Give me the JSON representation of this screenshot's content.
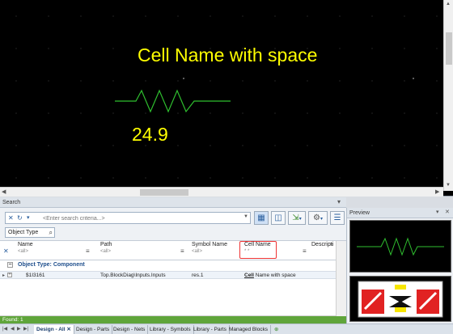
{
  "canvas": {
    "cell_name_text": "Cell Name with space",
    "value_text": "24.9"
  },
  "search": {
    "panel_title": "Search",
    "placeholder": "<Enter search criteria...>",
    "object_type_label": "Object Type",
    "columns": {
      "name": "Name",
      "path": "Path",
      "symbol_name": "Symbol Name",
      "cell_name": "Cell Name",
      "description": "Descripti"
    },
    "filters": {
      "name": "<all>",
      "path": "<all>",
      "symbol_name": "<all>",
      "cell_name": "* *"
    },
    "group_label": "Object Type: Component",
    "row": {
      "name": "$1I3161",
      "path": "Top.BlockDiag\\Inputs.Inputs",
      "symbol_name": "res.1",
      "cell_name_prefix": "Cell",
      "cell_name_rest": " Name with space"
    },
    "status": "Found: 1"
  },
  "tabs": [
    {
      "label": "Design - All",
      "active": true
    },
    {
      "label": "Design - Parts",
      "active": false
    },
    {
      "label": "Design - Nets",
      "active": false
    },
    {
      "label": "Library - Symbols",
      "active": false
    },
    {
      "label": "Library - Parts",
      "active": false
    },
    {
      "label": "Managed Blocks",
      "active": false
    }
  ],
  "preview": {
    "panel_title": "Preview"
  },
  "colors": {
    "schematic_text": "#ffff00",
    "resistor": "#2fbf2f",
    "status_bar": "#5fa53a",
    "highlight": "#e33333"
  },
  "icons": {
    "close": "close-icon",
    "refresh": "refresh-icon",
    "search": "search-icon",
    "settings": "gear-icon",
    "list": "list-icon"
  }
}
